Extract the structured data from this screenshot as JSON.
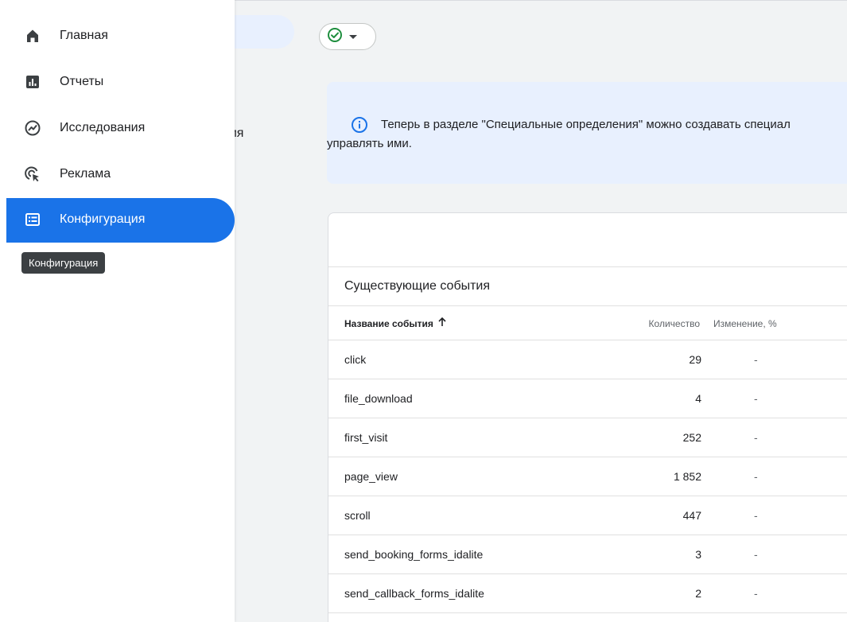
{
  "nav": {
    "items": [
      {
        "label": "Главная",
        "icon": "home-icon"
      },
      {
        "label": "Отчеты",
        "icon": "reports-bar-chart-icon"
      },
      {
        "label": "Исследования",
        "icon": "explore-icon"
      },
      {
        "label": "Реклама",
        "icon": "advertising-cursor-icon"
      },
      {
        "label": "Конфигурация",
        "icon": "configure-list-icon",
        "active": true
      }
    ],
    "tooltip": "Конфигурация"
  },
  "header": {
    "status_icon": "check-circle-icon",
    "status_color": "#1e8e3e"
  },
  "partial_text": "ния",
  "banner": {
    "icon": "info-icon",
    "line1": "Теперь в разделе \"Специальные определения\" можно создавать специал",
    "line2": "управлять ими."
  },
  "events_table": {
    "title": "Существующие события",
    "columns": {
      "name": "Название события",
      "count": "Количество",
      "change": "Изменение, %"
    },
    "sort_icon": "arrow-up-icon",
    "rows": [
      {
        "name": "click",
        "count": "29",
        "change": "-"
      },
      {
        "name": "file_download",
        "count": "4",
        "change": "-"
      },
      {
        "name": "first_visit",
        "count": "252",
        "change": "-"
      },
      {
        "name": "page_view",
        "count": "1 852",
        "change": "-"
      },
      {
        "name": "scroll",
        "count": "447",
        "change": "-"
      },
      {
        "name": "send_booking_forms_idalite",
        "count": "3",
        "change": "-"
      },
      {
        "name": "send_callback_forms_idalite",
        "count": "2",
        "change": "-"
      }
    ]
  },
  "colors": {
    "accent": "#1a73e8",
    "banner_bg": "#e8f0fe",
    "tooltip_bg": "#3c4043"
  }
}
